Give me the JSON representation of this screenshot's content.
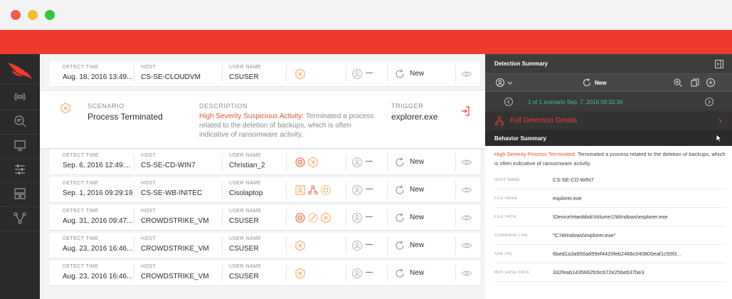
{
  "window": {
    "controls": [
      "close",
      "minimize",
      "maximize"
    ]
  },
  "sidebar": {
    "logo": "falcon-logo",
    "items": [
      "signal-icon",
      "search-icon",
      "monitor-icon",
      "sliders-icon",
      "dashboard-icon",
      "graph-icon"
    ]
  },
  "columns": {
    "detect_time": "DETECT TIME",
    "host": "HOST",
    "user_name": "USER NAME"
  },
  "rows": [
    {
      "detect_time": "Aug. 18, 2016 13:49...",
      "host": "CS-SE-CLOUDVM",
      "user": "CSUSER",
      "assignee": "—",
      "status": "New"
    },
    {
      "detect_time": "Sep. 6, 2016 12:49:...",
      "host": "CS-SE-CD-WIN7",
      "user": "Christian_2",
      "assignee": "—",
      "status": "New"
    },
    {
      "detect_time": "Sep. 1, 2016 09:29:19",
      "host": "CS-SE-WB-INITEC",
      "user": "Cisolaptop",
      "assignee": "—",
      "status": "New"
    },
    {
      "detect_time": "Aug. 31, 2016 09:47...",
      "host": "CROWDSTRIKE_VM",
      "user": "CSUSER",
      "assignee": "—",
      "status": "New"
    },
    {
      "detect_time": "Aug. 23, 2016 16:46...",
      "host": "CROWDSTRIKE_VM",
      "user": "CSUSER",
      "assignee": "—",
      "status": "New"
    },
    {
      "detect_time": "Aug. 23, 2016 16:46...",
      "host": "CROWDSTRIKE_VM",
      "user": "CSUSER",
      "assignee": "—",
      "status": "New"
    }
  ],
  "expanded": {
    "scenario_label": "SCENARIO",
    "scenario": "Process Terminated",
    "description_label": "DESCRIPTION",
    "description_highlight": "High Severity Suspicious Activity:",
    "description_text": " Terminated a process related to the deletion of backups, which is often indicative of ransomware activity.",
    "trigger_label": "TRIGGER",
    "trigger": "explorer.exe"
  },
  "panel": {
    "title": "Detection Summary",
    "status": "New",
    "nav_text": "1 of 1 scenario Sep. 7, 2016 08:32:36",
    "full_details": "Full Detection Details",
    "behavior_title": "Behavior Summary",
    "behavior_highlight": "High Severity Process Terminated:",
    "behavior_text": " Terminated a process related to the deletion of backups, which is often indicative of ransomware activity.",
    "fields": [
      {
        "label": "HOST NAME",
        "value": "CS-SE-CD-WIN7"
      },
      {
        "label": "FILE NAME",
        "value": "explorer.exe"
      },
      {
        "label": "FILE PATH",
        "value": "\\Device\\HarddiskVolume1\\Windows\\explorer.exe"
      },
      {
        "label": "COMMAND LINE",
        "value": "\"C:\\Windows\\explorer.exe\""
      },
      {
        "label": "SHA 256",
        "value": "6bed1a3a956a859ef4420feb2466c040800eaf1c55f3..."
      },
      {
        "label": "MD5 HASH DATA",
        "value": "332feab1435662fc6c672e25beb37be3"
      }
    ]
  },
  "colors": {
    "accent": "#ef3b2d",
    "severity_orange": "#f0a050",
    "severity_red": "#e5572e",
    "nav_green": "#3ac29a"
  }
}
